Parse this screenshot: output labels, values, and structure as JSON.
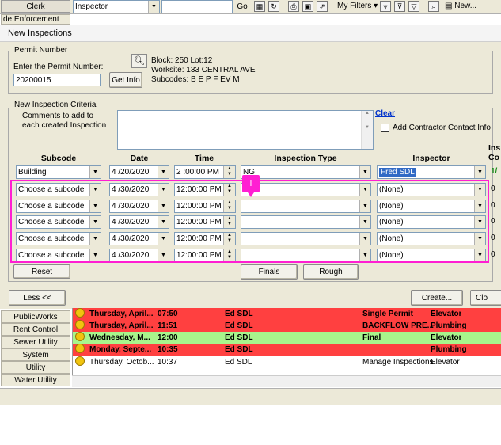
{
  "top_strip": {
    "left_tabs": [
      "Clerk",
      "de Enforcement"
    ],
    "query_combo": "Inspector",
    "go_label": "Go",
    "my_filters_label": "My Filters",
    "new_label": "New..."
  },
  "dialog": {
    "title": "New Inspections",
    "permit_group_label": "Permit Number",
    "permit_prompt": "Enter the Permit Number:",
    "permit_value": "20200015",
    "get_info_label": "Get Info",
    "block_text": "Block: 250 Lot:12",
    "worksite_text": "Worksite: 133 CENTRAL AVE",
    "subcodes_text": "Subcodes: B E P F EV M",
    "criteria_group_label": "New Inspection Criteria",
    "comments_label": "Comments to add to each created Inspection",
    "clear_link": "Clear",
    "add_contractor_label": "Add Contractor Contact Info",
    "headers": {
      "subcode": "Subcode",
      "date": "Date",
      "time": "Time",
      "inspection_type": "Inspection Type",
      "inspector": "Inspector",
      "cut1": "Ins",
      "cut2": "Co"
    },
    "rows": [
      {
        "subcode": "Building",
        "date": "4 /20/2020",
        "time": "2 :00:00 PM",
        "type": "NG",
        "inspector": "Fred SDL",
        "extra": "1/"
      },
      {
        "subcode": "Choose a subcode",
        "date": "4 /30/2020",
        "time": "12:00:00 PM",
        "type": "",
        "inspector": "(None)",
        "extra": "0"
      },
      {
        "subcode": "Choose a subcode",
        "date": "4 /30/2020",
        "time": "12:00:00 PM",
        "type": "",
        "inspector": "(None)",
        "extra": "0"
      },
      {
        "subcode": "Choose a subcode",
        "date": "4 /30/2020",
        "time": "12:00:00 PM",
        "type": "",
        "inspector": "(None)",
        "extra": "0"
      },
      {
        "subcode": "Choose a subcode",
        "date": "4 /30/2020",
        "time": "12:00:00 PM",
        "type": "",
        "inspector": "(None)",
        "extra": "0"
      },
      {
        "subcode": "Choose a subcode",
        "date": "4 /30/2020",
        "time": "12:00:00 PM",
        "type": "",
        "inspector": "(None)",
        "extra": "0"
      }
    ],
    "reset_label": "Reset",
    "finals_label": "Finals",
    "rough_label": "Rough",
    "less_label": "Less <<",
    "create_label": "Create...",
    "close_label": "Clo",
    "tooltip_badge": "i"
  },
  "background": {
    "side_menu": [
      "PublicWorks",
      "Rent Control",
      "Sewer Utility",
      "System",
      "Utility",
      "Water Utility"
    ],
    "list_rows": [
      {
        "date": "Thursday, April...",
        "time": "07:50",
        "who": "Ed SDL",
        "desc": "Single Permit",
        "cat": "Elevator",
        "color": "#ff4040",
        "bold": true
      },
      {
        "date": "Thursday, April...",
        "time": "11:51",
        "who": "Ed SDL",
        "desc": "BACKFLOW PRE...",
        "cat": "Plumbing",
        "color": "#ff4040",
        "bold": true
      },
      {
        "date": "Wednesday, M...",
        "time": "12:00",
        "who": "Ed SDL",
        "desc": "Final",
        "cat": "Elevator",
        "color": "#a8f58c",
        "bold": true
      },
      {
        "date": "Monday, Septe...",
        "time": "10:35",
        "who": "Ed SDL",
        "desc": "",
        "cat": "Plumbing",
        "color": "#ff4040",
        "bold": true
      },
      {
        "date": "Thursday, Octob...",
        "time": "10:37",
        "who": "Ed SDL",
        "desc": "Manage Inspections",
        "cat": "Elevator",
        "color": "#ffffff",
        "bold": false
      }
    ]
  },
  "colors": {
    "highlight": "#ff1fd2",
    "link": "#0033cc",
    "selected": "#316ac5"
  }
}
